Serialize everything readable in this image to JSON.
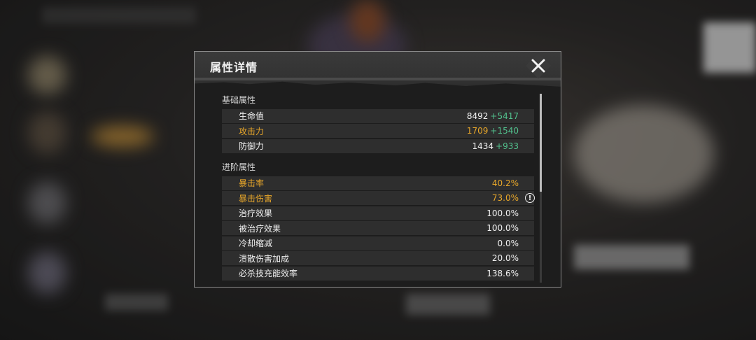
{
  "dialog": {
    "title": "属性详情"
  },
  "basic": {
    "title": "基础属性",
    "rows": [
      {
        "label": "生命值",
        "base": "8492",
        "bonus": "+5417"
      },
      {
        "label": "攻击力",
        "base": "1709",
        "bonus": "+1540"
      },
      {
        "label": "防御力",
        "base": "1434",
        "bonus": "+933"
      }
    ]
  },
  "advanced": {
    "title": "进阶属性",
    "rows": [
      {
        "label": "暴击率",
        "value": "40.2%"
      },
      {
        "label": "暴击伤害",
        "value": "73.0%"
      },
      {
        "label": "治疗效果",
        "value": "100.0%"
      },
      {
        "label": "被治疗效果",
        "value": "100.0%"
      },
      {
        "label": "冷却缩减",
        "value": "0.0%"
      },
      {
        "label": "溃散伤害加成",
        "value": "20.0%"
      },
      {
        "label": "必杀技充能效率",
        "value": "138.6%"
      }
    ]
  },
  "icons": {
    "close": "close-icon",
    "info": "info-icon"
  },
  "colors": {
    "highlight": "#e8a72a",
    "bonus": "#52c28e",
    "text": "#f0f0f0",
    "row_bg": "#2e2e2e"
  }
}
